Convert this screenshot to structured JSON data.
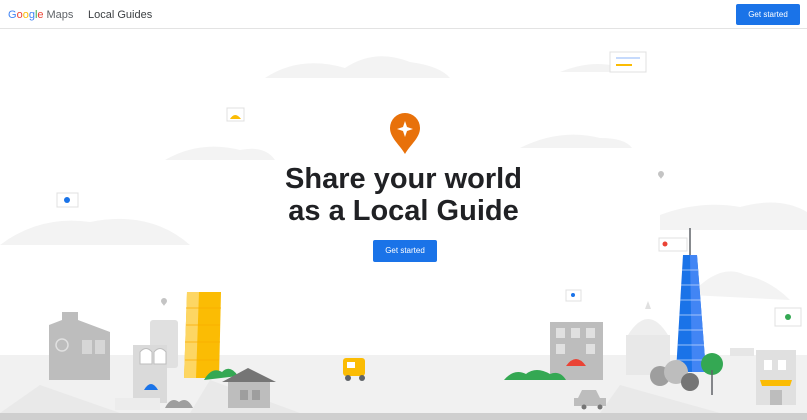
{
  "header": {
    "brand_google": [
      "G",
      "o",
      "o",
      "g",
      "l",
      "e"
    ],
    "brand_product": "Maps",
    "nav_link": "Local Guides",
    "cta_label": "Get started"
  },
  "hero": {
    "headline_line1": "Share your world",
    "headline_line2": "as a Local Guide",
    "cta_label": "Get started"
  },
  "colors": {
    "primary_blue": "#1a73e8",
    "badge_orange": "#e8710a",
    "building_yellow": "#fbbc04",
    "tower_blue": "#1a73e8",
    "tree_green": "#34a853"
  },
  "icons": [
    "local-guide-badge-icon",
    "map-pin-icon",
    "review-card-icon",
    "photo-card-icon",
    "tuk-tuk-icon",
    "car-icon"
  ]
}
